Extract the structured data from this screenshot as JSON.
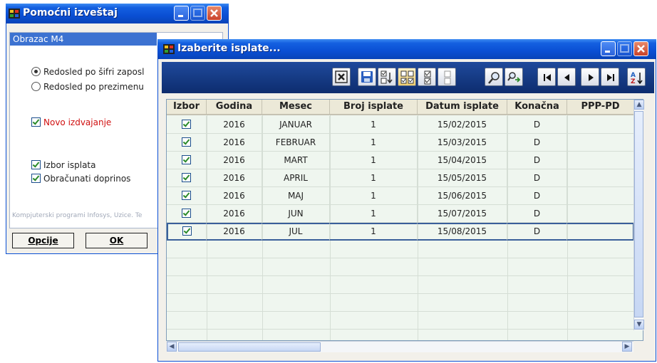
{
  "bg_window": {
    "title": "Pomoćni izveštaj",
    "group_title": "Obrazac M4",
    "sort_options": [
      {
        "label": "Redosled po šifri zaposl",
        "selected": true
      },
      {
        "label": "Redosled po prezimenu",
        "selected": false
      }
    ],
    "novo_izdvajanje": {
      "label": "Novo izdvajanje",
      "checked": true
    },
    "izbor_isplata": {
      "label": "Izbor isplata",
      "checked": true
    },
    "obracunati_doprinos": {
      "label": "Obračunati doprinos",
      "checked": true
    },
    "credit": "Kompjuterski programi Infosys, Uzice. Te",
    "buttons": {
      "opcije": "Opcije",
      "ok": "OK"
    }
  },
  "main_window": {
    "title": "Izaberite isplate...",
    "toolbar_icons": [
      "close-icon",
      "save-icon",
      "check-toggle-icon",
      "check-all-icon",
      "check-single-icon",
      "uncheck-icon",
      "search-icon",
      "search-next-icon",
      "first-record-icon",
      "prev-record-icon",
      "next-record-icon",
      "last-record-icon",
      "sort-az-icon"
    ],
    "grid": {
      "columns": [
        "Izbor",
        "Godina",
        "Mesec",
        "Broj isplate",
        "Datum isplate",
        "Konačna",
        "PPP-PD"
      ],
      "rows": [
        {
          "izbor": true,
          "godina": "2016",
          "mesec": "JANUAR",
          "broj": "1",
          "datum": "15/02/2015",
          "konacna": "D",
          "ppp": ""
        },
        {
          "izbor": true,
          "godina": "2016",
          "mesec": "FEBRUAR",
          "broj": "1",
          "datum": "15/03/2015",
          "konacna": "D",
          "ppp": ""
        },
        {
          "izbor": true,
          "godina": "2016",
          "mesec": "MART",
          "broj": "1",
          "datum": "15/04/2015",
          "konacna": "D",
          "ppp": ""
        },
        {
          "izbor": true,
          "godina": "2016",
          "mesec": "APRIL",
          "broj": "1",
          "datum": "15/05/2015",
          "konacna": "D",
          "ppp": ""
        },
        {
          "izbor": true,
          "godina": "2016",
          "mesec": "MAJ",
          "broj": "1",
          "datum": "15/06/2015",
          "konacna": "D",
          "ppp": ""
        },
        {
          "izbor": true,
          "godina": "2016",
          "mesec": "JUN",
          "broj": "1",
          "datum": "15/07/2015",
          "konacna": "D",
          "ppp": ""
        },
        {
          "izbor": true,
          "godina": "2016",
          "mesec": "JUL",
          "broj": "1",
          "datum": "15/08/2015",
          "konacna": "D",
          "ppp": "",
          "selected": true
        }
      ]
    }
  },
  "colors": {
    "titlebar": "#0a4fd4",
    "grid_bg": "#eff6ef",
    "group_header": "#3c72d1",
    "accent_red": "#d01010"
  }
}
